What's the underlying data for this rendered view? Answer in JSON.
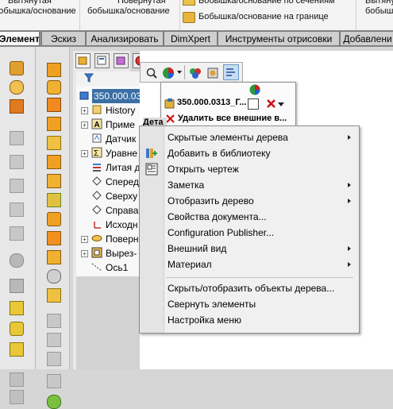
{
  "ribbon": {
    "col1_line1": "Вытянутая",
    "col1_line2": "бобышка/основание",
    "col2_line1": "Повернутая",
    "col2_line2": "бобышка/основание",
    "col3_line1": "Бобышка/основание по сечениям",
    "col3_line2": "Бобышка/основание на границе",
    "col4_line1": "Вытянута",
    "col4_line2": "бобышка"
  },
  "tabs": [
    {
      "label": "Элементы"
    },
    {
      "label": "Эскиз"
    },
    {
      "label": "Анализировать"
    },
    {
      "label": "DimXpert"
    },
    {
      "label": "Инструменты отрисовки"
    },
    {
      "label": "Добавлени"
    }
  ],
  "tree": {
    "root": "350.000.03",
    "items": [
      {
        "label": "History"
      },
      {
        "label": "Приме"
      },
      {
        "label": "Датчик"
      },
      {
        "label": "Уравне"
      },
      {
        "label": "Литая д"
      },
      {
        "label": "Сперед"
      },
      {
        "label": "Сверху"
      },
      {
        "label": "Справа"
      },
      {
        "label": "Исходн"
      },
      {
        "label": "Поверн"
      },
      {
        "label": "Вырез-"
      },
      {
        "label": "Ось1"
      }
    ]
  },
  "context_toolbar": {
    "part_name": "350.000.0313_Г...",
    "delete_external": "Удалить все внешние в...",
    "details_tag": "Дета"
  },
  "menu": {
    "items": [
      {
        "label": "Скрытые элементы дерева",
        "submenu": true
      },
      {
        "label": "Добавить в библиотеку",
        "submenu": false
      },
      {
        "label": "Открыть чертеж",
        "submenu": false
      },
      {
        "label": "Заметка",
        "submenu": true
      },
      {
        "label": "Отобразить дерево",
        "submenu": true
      },
      {
        "label": "Свойства документа...",
        "submenu": false
      },
      {
        "label": "Configuration Publisher...",
        "submenu": false
      },
      {
        "label": "Внешний вид",
        "submenu": true
      },
      {
        "label": "Материал",
        "submenu": true
      },
      {
        "label": "Скрыть/отобразить объекты дерева...",
        "submenu": false
      },
      {
        "label": "Свернуть элементы",
        "submenu": false
      },
      {
        "label": "Настройка меню",
        "submenu": false
      }
    ]
  },
  "colors": {
    "accent_selection": "#3a6ea5",
    "delete_red": "#d01010",
    "active_tab_bg": "#fafafa"
  },
  "icons": [
    "search-icon",
    "appearance-icon",
    "filter-icon",
    "part-icon",
    "delete-icon",
    "library-add-icon",
    "drawing-icon"
  ]
}
